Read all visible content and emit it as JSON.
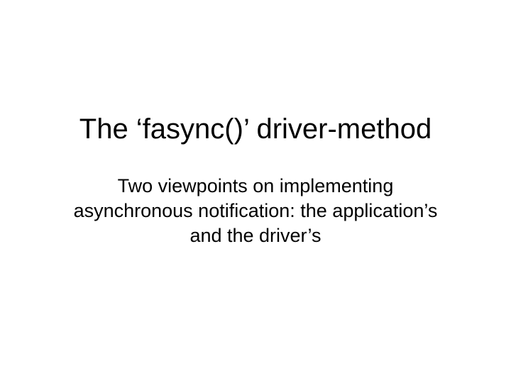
{
  "slide": {
    "title": "The ‘fasync()’ driver-method",
    "subtitle": "Two viewpoints on implementing asynchronous notification: the application’s and the driver’s"
  }
}
